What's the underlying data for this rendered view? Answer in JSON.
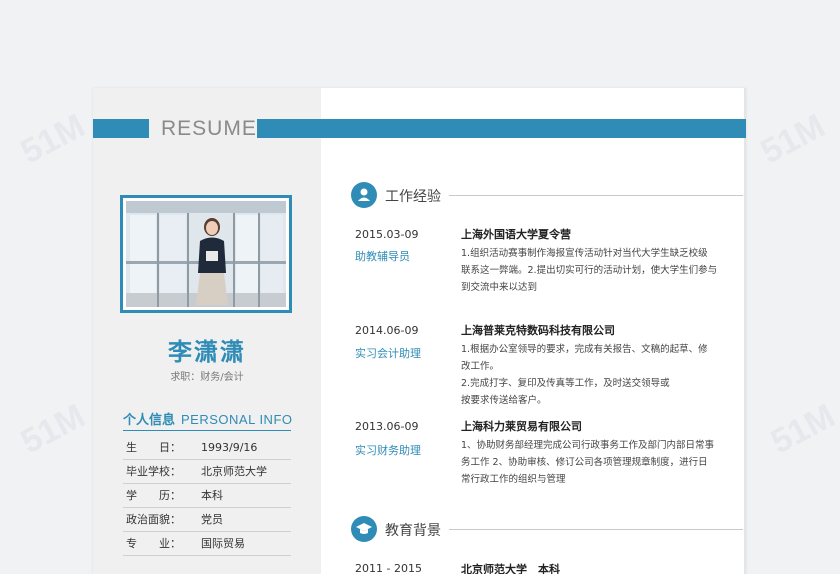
{
  "header": {
    "resume_word": "RESUME"
  },
  "profile": {
    "name": "李潇潇",
    "job": "求职：财务/会计"
  },
  "personal_info": {
    "title_zh": "个人信息",
    "title_en": "PERSONAL INFO",
    "rows": [
      {
        "label": "生　　日：",
        "value": "1993/9/16"
      },
      {
        "label": "毕业学校：",
        "value": "北京师范大学"
      },
      {
        "label": "学　　历：",
        "value": "本科"
      },
      {
        "label": "政治面貌：",
        "value": "党员"
      },
      {
        "label": "专　　业：",
        "value": "国际贸易"
      }
    ]
  },
  "work": {
    "title": "工作经验",
    "icon": "person-icon",
    "items": [
      {
        "date": "2015.03-09",
        "role": "助教辅导员",
        "company": "上海外国语大学夏令营",
        "lines": [
          "1.组织活动赛事制作海报宣传活动针对当代大学生缺乏校级",
          "联系这一弊端。2.提出切实可行的活动计划，使大学生们参与",
          "到交流中来以达到"
        ]
      },
      {
        "date": "2014.06-09",
        "role": "实习会计助理",
        "company": "上海普莱克特数码科技有限公司",
        "lines": [
          "1.根据办公室领导的要求，完成有关报告、文稿的起草、修",
          "改工作。",
          "2.完成打字、复印及传真等工作，及时送交领导或",
          "按要求传送给客户。"
        ]
      },
      {
        "date": "2013.06-09",
        "role": "实习财务助理",
        "company": "上海科力莱贸易有限公司",
        "lines": [
          "1、协助财务部经理完成公司行政事务工作及部门内部日常事",
          "务工作  2、协助审核、修订公司各项管理规章制度，进行日",
          "常行政工作的组织与管理"
        ]
      }
    ]
  },
  "education": {
    "title": "教育背景",
    "icon": "graduation-cap-icon",
    "items": [
      {
        "date": "2011 - 2015",
        "school": "北京师范大学　本科"
      }
    ]
  },
  "colors": {
    "accent": "#2f8cb6",
    "sidebar_bg": "#f0f0f0"
  }
}
